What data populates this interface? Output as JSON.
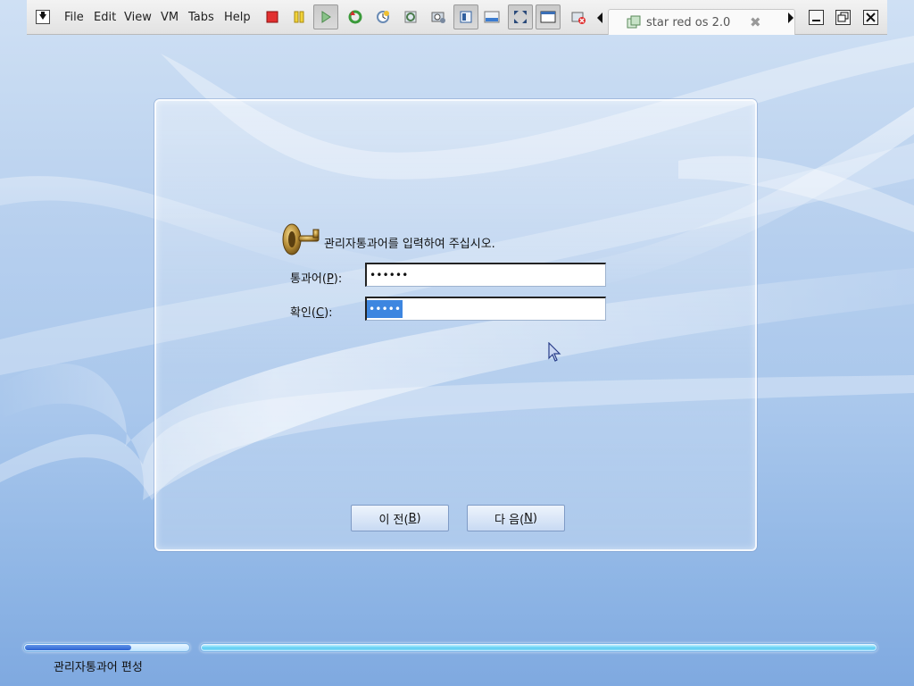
{
  "vm_toolbar": {
    "menu": [
      "File",
      "Edit",
      "View",
      "VM",
      "Tabs",
      "Help"
    ],
    "buttons": [
      "power-off-icon",
      "suspend-icon",
      "play-icon",
      "revert-icon",
      "snapshot-icon",
      "snapshot-manager-icon",
      "snapshot-settings-icon",
      "quick-switch-icon",
      "console-view-icon",
      "full-screen-icon",
      "unity-icon",
      "close-vm-icon"
    ],
    "tab": {
      "label": "star red os 2.0"
    }
  },
  "installer": {
    "prompt": "관리자통과어를 입력하여 주십시오.",
    "password": {
      "label_prefix": "통과어(",
      "label_key": "P",
      "label_suffix": "):",
      "value": "••••••"
    },
    "confirm": {
      "label_prefix": "확인(",
      "label_key": "C",
      "label_suffix": "):",
      "value": "•••••"
    },
    "back_button": {
      "text": "이 전(",
      "key": "B",
      "suffix": ")"
    },
    "next_button": {
      "text": "다 음(",
      "key": "N",
      "suffix": ")"
    }
  },
  "progress": {
    "step_fraction": 0.65,
    "overall_fraction": 1.0,
    "caption": "관리자통과어 편성"
  },
  "colors": {
    "selection": "#3d86e0",
    "progress_blue": "#2e63d2",
    "progress_cyan": "#5ccdf3"
  }
}
